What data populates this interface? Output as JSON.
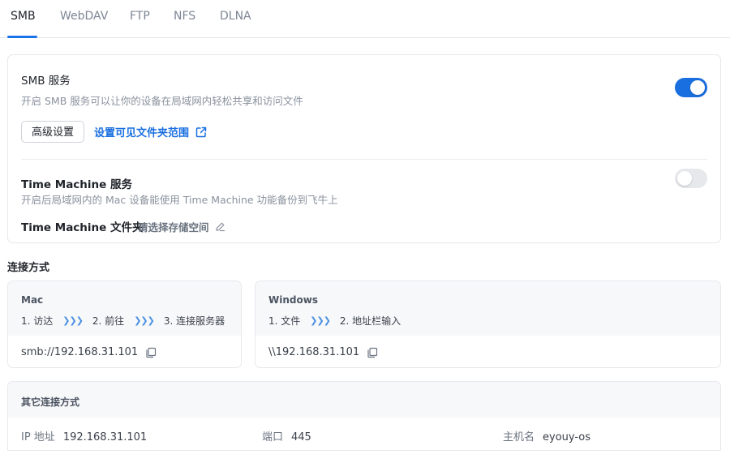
{
  "tabs": [
    {
      "label": "SMB",
      "active": true
    },
    {
      "label": "WebDAV",
      "active": false
    },
    {
      "label": "FTP",
      "active": false
    },
    {
      "label": "NFS",
      "active": false
    },
    {
      "label": "DLNA",
      "active": false
    }
  ],
  "smb": {
    "title": "SMB 服务",
    "description": "开启 SMB 服务可以让你的设备在局域网内轻松共享和访问文件",
    "enabled": true,
    "advanced_button": "高级设置",
    "visible_folders_link": "设置可见文件夹范围"
  },
  "time_machine": {
    "title": "Time Machine 服务",
    "description": "开启后局域网内的 Mac 设备能使用 Time Machine 功能备份到飞牛上",
    "enabled": false,
    "folder_label": "Time Machine 文件夹",
    "folder_placeholder": "请选择存储空间"
  },
  "connection": {
    "heading": "连接方式",
    "mac": {
      "name": "Mac",
      "steps": [
        "1. 访达",
        "2. 前往",
        "3. 连接服务器"
      ],
      "address": "smb://192.168.31.101"
    },
    "windows": {
      "name": "Windows",
      "steps": [
        "1. 文件",
        "2. 地址栏输入"
      ],
      "address": "\\\\192.168.31.101"
    },
    "chevron": "❯❯❯"
  },
  "other": {
    "title": "其它连接方式",
    "ip_label": "IP 地址",
    "ip_value": "192.168.31.101",
    "port_label": "端口",
    "port_value": "445",
    "host_label": "主机名",
    "host_value": "eyouy-os"
  },
  "colors": {
    "accent": "#1a6fe0",
    "toggle_off": "#e6e8eb"
  }
}
